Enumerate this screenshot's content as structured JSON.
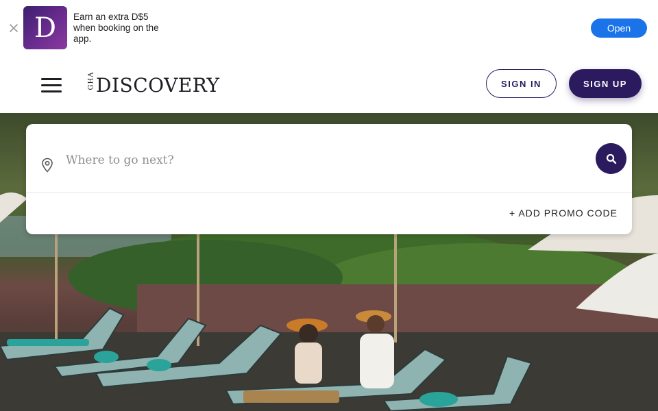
{
  "app_banner": {
    "close_icon": "close-icon",
    "app_icon_letter": "D",
    "text": "Earn an extra D$5 when booking on the app.",
    "open_label": "Open",
    "accent_color": "#1a73e8"
  },
  "header": {
    "menu_icon": "hamburger-menu-icon",
    "logo": {
      "prefix": "GHA",
      "word": "DISCOVERY"
    },
    "sign_in_label": "SIGN IN",
    "sign_up_label": "SIGN UP",
    "brand_color": "#2b1b5e"
  },
  "search": {
    "pin_icon": "location-pin-icon",
    "placeholder": "Where to go next?",
    "value": "",
    "search_icon": "search-icon",
    "promo_label": "+ ADD PROMO CODE"
  },
  "hero": {
    "description_icon": "hero-photo"
  }
}
